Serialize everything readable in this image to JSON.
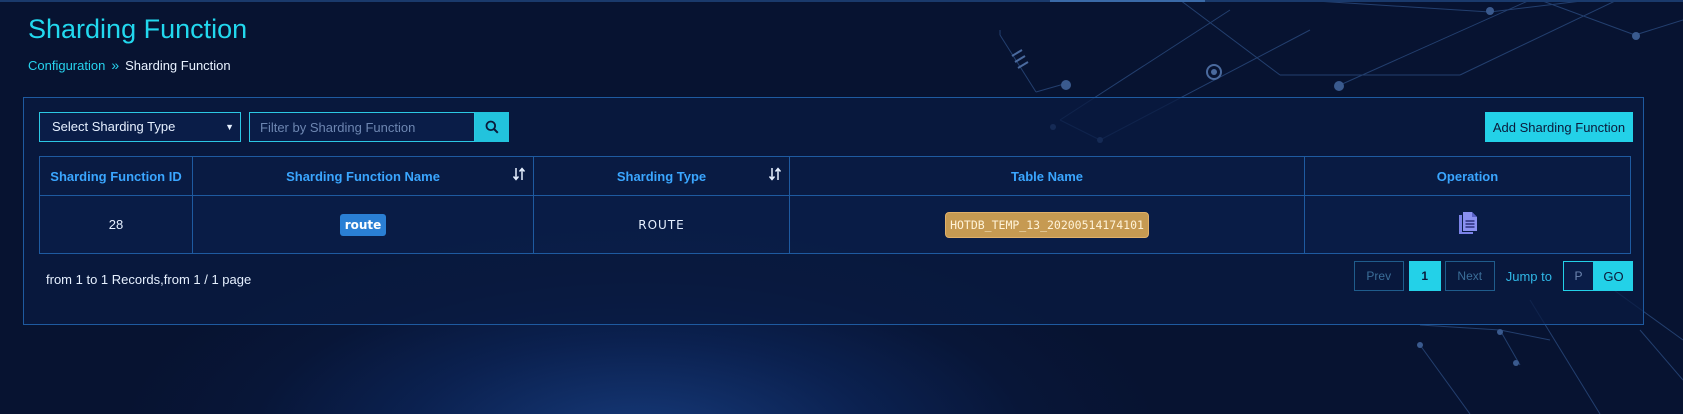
{
  "page": {
    "title": "Sharding Function",
    "breadcrumb": {
      "parent": "Configuration",
      "separator": "»",
      "current": "Sharding Function"
    }
  },
  "toolbar": {
    "select_placeholder": "Select Sharding Type",
    "filter_placeholder": "Filter by Sharding Function",
    "add_button_label": "Add Sharding Function",
    "search_icon": "search-icon"
  },
  "table": {
    "headers": {
      "id": "Sharding Function ID",
      "name": "Sharding Function Name",
      "type": "Sharding Type",
      "table_name": "Table Name",
      "operation": "Operation"
    },
    "rows": [
      {
        "id": "28",
        "name": "route",
        "type": "ROUTE",
        "table_name": "HOTDB_TEMP_13_20200514174101",
        "operation_icon": "document-icon"
      }
    ]
  },
  "footer": {
    "records_info": "from 1 to 1 Records,from 1 / 1 page",
    "prev_label": "Prev",
    "current_page": "1",
    "next_label": "Next",
    "jump_label": "Jump to",
    "jump_placeholder": "P",
    "go_label": "GO"
  },
  "colors": {
    "accent": "#23d1e8",
    "header_text": "#3aa6ff",
    "route_badge": "#2a7fd4",
    "table_badge": "#c69a52",
    "background": "#081638"
  }
}
